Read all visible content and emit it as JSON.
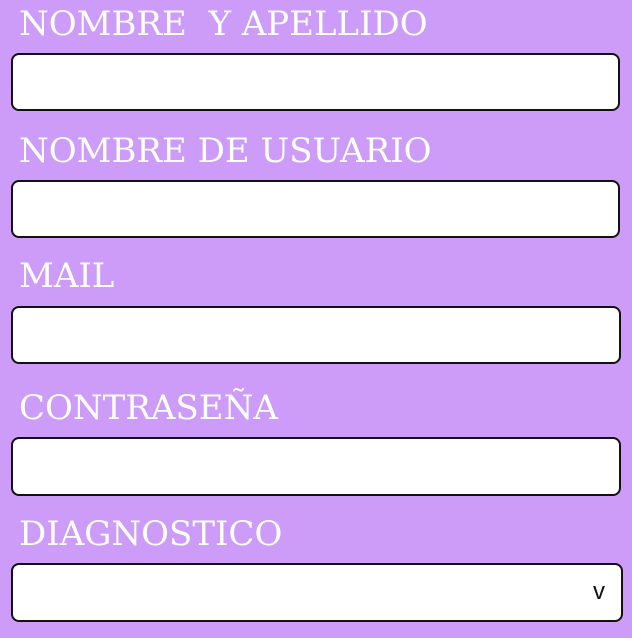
{
  "form": {
    "fields": [
      {
        "label": "NOMBRE  Y APELLIDO",
        "value": "",
        "placeholder": ""
      },
      {
        "label": "NOMBRE DE USUARIO",
        "value": "",
        "placeholder": ""
      },
      {
        "label": "MAIL",
        "value": "",
        "placeholder": ""
      },
      {
        "label": "CONTRASEÑA",
        "value": "",
        "placeholder": ""
      }
    ],
    "diagnostico": {
      "label": "DIAGNOSTICO",
      "selected": "",
      "chevron_glyph": "v",
      "chevron_icon": "chevron-down-icon"
    }
  },
  "colors": {
    "background": "#cd9cf8",
    "label_text": "#ffffff",
    "field_background": "#ffffff",
    "field_border": "#111111"
  }
}
